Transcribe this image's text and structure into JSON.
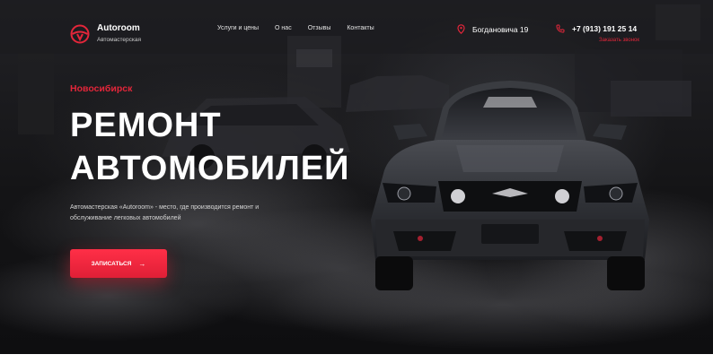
{
  "header": {
    "logo_name": "Autoroom",
    "logo_subtitle": "Автомастерская",
    "nav": [
      "Услуги и цены",
      "О нас",
      "Отзывы",
      "Контакты"
    ],
    "address": "Богдановича 19",
    "phone": "+7 (913) 191 25 14",
    "callback_label": "Заказать звонок"
  },
  "hero": {
    "city": "Новосибирск",
    "headline_line1": "РЕМОНТ",
    "headline_line2": "АВТОМОБИЛЕЙ",
    "description": "Автомастерская «Autoroom» - место, где производится ремонт и обслуживание легковых автомобилей",
    "cta_label": "ЗАПИСАТЬСЯ",
    "cta_arrow": "→"
  },
  "icons": {
    "logo": "steering-wheel-icon",
    "address": "map-pin-icon",
    "phone": "phone-icon",
    "cta": "arrow-right-icon"
  },
  "colors": {
    "accent": "#e3263a",
    "background": "#141416",
    "text": "#ffffff"
  }
}
